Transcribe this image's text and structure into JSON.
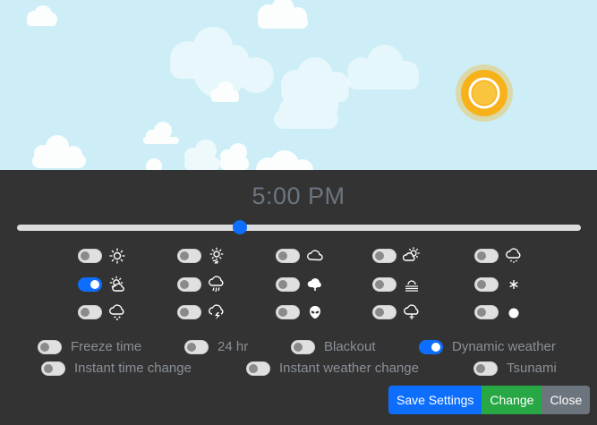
{
  "time_display": "5:00 PM",
  "time_slider": {
    "value_fraction": 0.395
  },
  "weather_options": [
    {
      "name": "sun-icon",
      "on": false
    },
    {
      "name": "sun-haze-icon",
      "on": false
    },
    {
      "name": "cloud-icon",
      "on": false
    },
    {
      "name": "partly-cloudy-icon",
      "on": false
    },
    {
      "name": "cloud-drizzle-icon",
      "on": false
    },
    {
      "name": "sun-cloud-icon",
      "on": true
    },
    {
      "name": "cloud-rain-icon",
      "on": false
    },
    {
      "name": "cloud-snow-icon",
      "on": false
    },
    {
      "name": "fog-icon",
      "on": false
    },
    {
      "name": "snowflake-icon",
      "on": false
    },
    {
      "name": "cloud-sleet-icon",
      "on": false
    },
    {
      "name": "cloud-lightning-icon",
      "on": false
    },
    {
      "name": "alien-icon",
      "on": false
    },
    {
      "name": "cloud-hail-icon",
      "on": false
    },
    {
      "name": "moon-icon",
      "on": false
    }
  ],
  "settings": {
    "freeze_time": {
      "label": "Freeze time",
      "on": false
    },
    "twenty_four_hr": {
      "label": "24 hr",
      "on": false
    },
    "blackout": {
      "label": "Blackout",
      "on": false
    },
    "dynamic_weather": {
      "label": "Dynamic weather",
      "on": true
    },
    "instant_time_change": {
      "label": "Instant time change",
      "on": false
    },
    "instant_weather_change": {
      "label": "Instant weather change",
      "on": false
    },
    "tsunami": {
      "label": "Tsunami",
      "on": false
    }
  },
  "buttons": {
    "save": "Save Settings",
    "change": "Change",
    "close": "Close"
  },
  "colors": {
    "sky": "#cdeef7",
    "panel": "#333333",
    "accent": "#0d6efd",
    "success": "#28a745",
    "secondary": "#6c757d",
    "sun": "#f7b21a"
  }
}
